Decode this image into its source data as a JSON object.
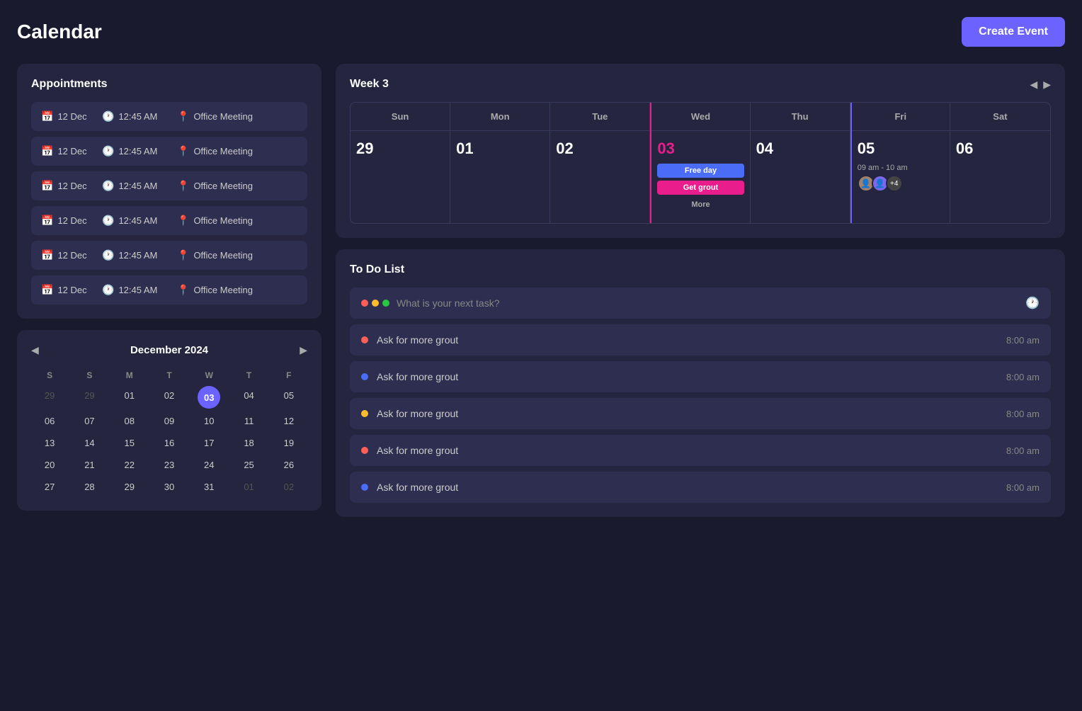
{
  "header": {
    "title": "Calendar",
    "create_button_label": "Create Event"
  },
  "appointments": {
    "title": "Appointments",
    "items": [
      {
        "date": "12 Dec",
        "time": "12:45 AM",
        "location": "Office Meeting"
      },
      {
        "date": "12 Dec",
        "time": "12:45 AM",
        "location": "Office Meeting"
      },
      {
        "date": "12 Dec",
        "time": "12:45 AM",
        "location": "Office Meeting"
      },
      {
        "date": "12 Dec",
        "time": "12:45 AM",
        "location": "Office Meeting"
      },
      {
        "date": "12 Dec",
        "time": "12:45 AM",
        "location": "Office Meeting"
      },
      {
        "date": "12 Dec",
        "time": "12:45 AM",
        "location": "Office Meeting"
      }
    ]
  },
  "mini_calendar": {
    "title": "December 2024",
    "day_headers": [
      "S",
      "S",
      "M",
      "T",
      "W",
      "T",
      "F"
    ],
    "weeks": [
      [
        "29",
        "29",
        "01",
        "02",
        "03",
        "04",
        "05"
      ],
      [
        "06",
        "07",
        "08",
        "09",
        "10",
        "11",
        "12"
      ],
      [
        "13",
        "14",
        "15",
        "16",
        "17",
        "18",
        "19"
      ],
      [
        "20",
        "21",
        "22",
        "23",
        "24",
        "25",
        "26"
      ],
      [
        "27",
        "28",
        "29",
        "30",
        "31",
        "01",
        "02"
      ]
    ],
    "today": "03",
    "today_index": "4"
  },
  "week_calendar": {
    "title": "Week 3",
    "days": [
      {
        "name": "Sun",
        "number": "29",
        "events": []
      },
      {
        "name": "Mon",
        "number": "01",
        "events": []
      },
      {
        "name": "Tue",
        "number": "02",
        "events": []
      },
      {
        "name": "Wed",
        "number": "03",
        "events": [
          {
            "label": "Free day",
            "type": "blue"
          },
          {
            "label": "Get grout",
            "type": "pink"
          },
          {
            "label": "More",
            "type": "more"
          }
        ]
      },
      {
        "name": "Thu",
        "number": "04",
        "events": []
      },
      {
        "name": "Fri",
        "number": "05",
        "events": [
          {
            "label": "09 am - 10 am",
            "type": "time"
          }
        ]
      },
      {
        "name": "Sat",
        "number": "06",
        "events": []
      }
    ]
  },
  "todo": {
    "title": "To Do List",
    "input_placeholder": "What is your next task?",
    "items": [
      {
        "text": "Ask for more grout",
        "time": "8:00 am",
        "dot_color": "red"
      },
      {
        "text": "Ask for more grout",
        "time": "8:00 am",
        "dot_color": "blue"
      },
      {
        "text": "Ask for more grout",
        "time": "8:00 am",
        "dot_color": "yellow"
      },
      {
        "text": "Ask for more grout",
        "time": "8:00 am",
        "dot_color": "red"
      },
      {
        "text": "Ask for more grout",
        "time": "8:00 am",
        "dot_color": "blue"
      }
    ]
  }
}
